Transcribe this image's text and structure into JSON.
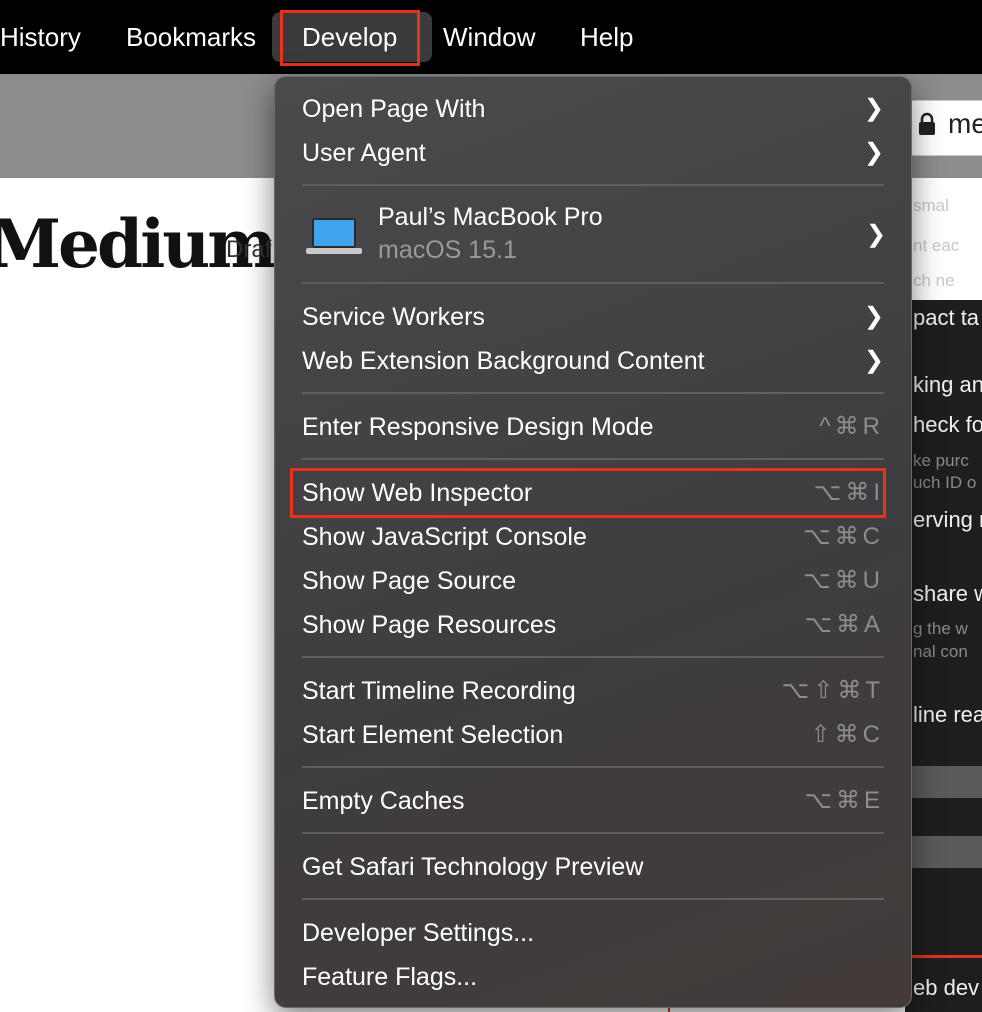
{
  "menubar": {
    "items": [
      "History",
      "Bookmarks",
      "Develop",
      "Window",
      "Help"
    ]
  },
  "browser": {
    "address_partial": "me",
    "logo": "Medium",
    "draft_partial": "Draf"
  },
  "right_peek": {
    "lines": [
      "smal",
      "nt eac",
      "ch ne",
      "pact ta",
      "king an",
      "heck fo",
      "ke purc",
      "uch ID o",
      "erving n",
      "share w",
      "g the w",
      "nal con",
      "line rea",
      "eb dev"
    ]
  },
  "menu": {
    "open_page_with": "Open Page With",
    "user_agent": "User Agent",
    "device_name": "Paul’s MacBook Pro",
    "device_os": "macOS 15.1",
    "service_workers": "Service Workers",
    "web_extension_bg": "Web Extension Background Content",
    "responsive": {
      "label": "Enter Responsive Design Mode",
      "shortcut": "^⌘R"
    },
    "web_inspector": {
      "label": "Show Web Inspector",
      "shortcut": "⌥⌘I"
    },
    "js_console": {
      "label": "Show JavaScript Console",
      "shortcut": "⌥⌘C"
    },
    "page_source": {
      "label": "Show Page Source",
      "shortcut": "⌥⌘U"
    },
    "page_resources": {
      "label": "Show Page Resources",
      "shortcut": "⌥⌘A"
    },
    "timeline": {
      "label": "Start Timeline Recording",
      "shortcut": "⌥⇧⌘T"
    },
    "element_selection": {
      "label": "Start Element Selection",
      "shortcut": "⇧⌘C"
    },
    "empty_caches": {
      "label": "Empty Caches",
      "shortcut": "⌥⌘E"
    },
    "tech_preview": "Get Safari Technology Preview",
    "dev_settings": "Developer Settings...",
    "feature_flags": "Feature Flags..."
  },
  "icons": {
    "chevron": "chevron-right-icon",
    "lock": "lock-icon",
    "laptop": "laptop-icon"
  },
  "colors": {
    "highlight": "#e8321a",
    "menu_bg": "#434244",
    "menubar_bg": "#000000"
  }
}
